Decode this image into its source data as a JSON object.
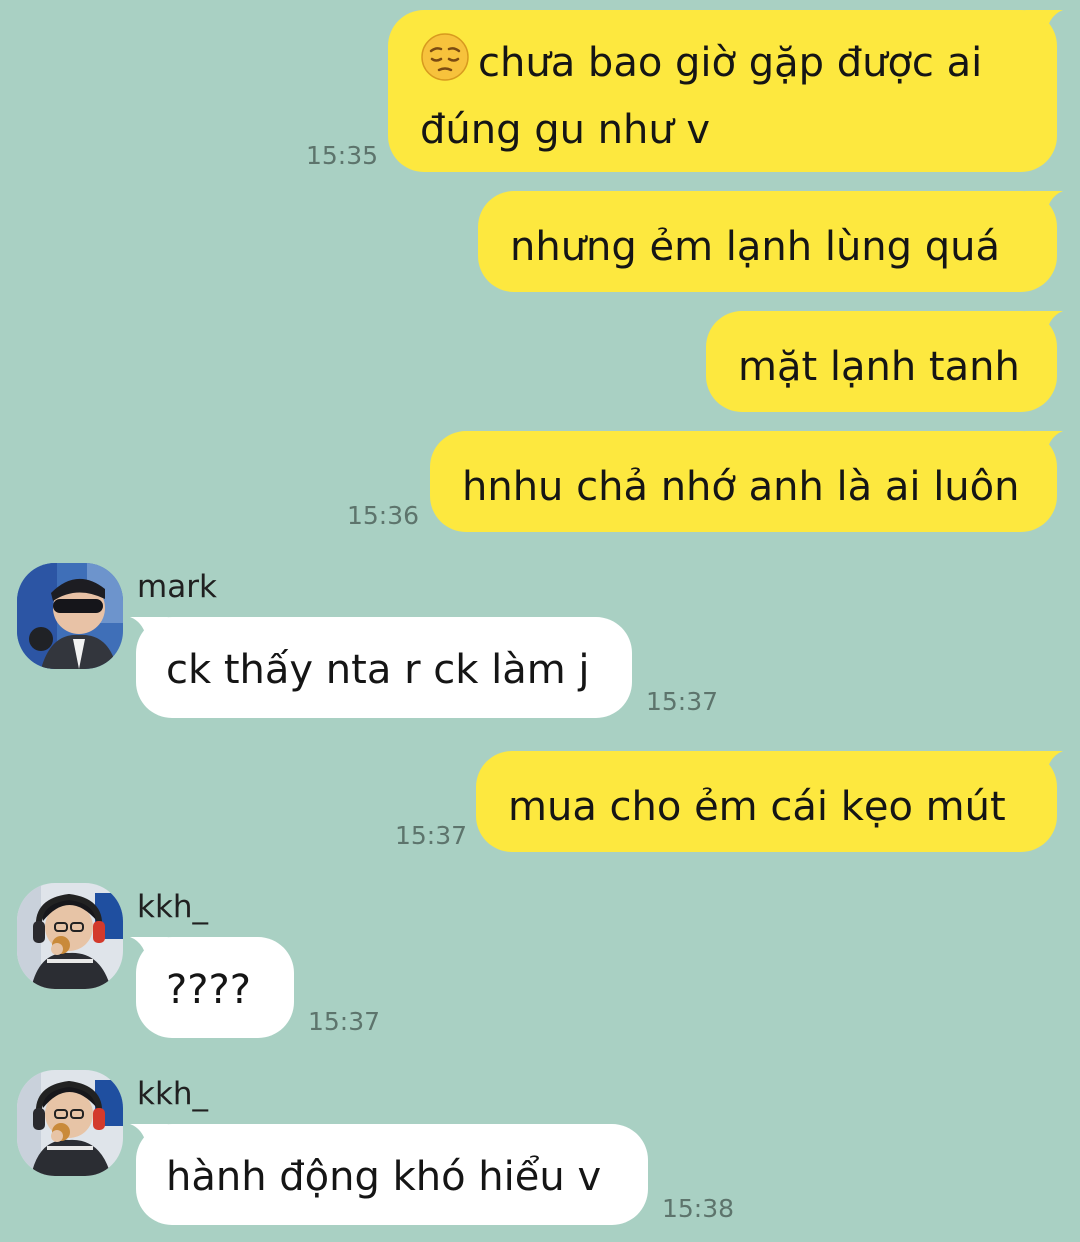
{
  "chat": {
    "messages": [
      {
        "id": "m1",
        "direction": "outgoing",
        "time": "15:35",
        "emoji": "pensive-face",
        "line1": "chưa bao giờ gặp được ai",
        "line2": "đúng gu như v"
      },
      {
        "id": "m2",
        "direction": "outgoing",
        "text": "nhưng ẻm lạnh lùng quá"
      },
      {
        "id": "m3",
        "direction": "outgoing",
        "text": "mặt lạnh tanh"
      },
      {
        "id": "m4",
        "direction": "outgoing",
        "time": "15:36",
        "text": "hnhu chả nhớ anh là ai luôn"
      },
      {
        "id": "m5",
        "direction": "incoming",
        "sender": "mark",
        "time": "15:37",
        "text": "ck thấy nta r ck làm j"
      },
      {
        "id": "m6",
        "direction": "outgoing",
        "time": "15:37",
        "text": "mua cho ẻm cái kẹo mút"
      },
      {
        "id": "m7",
        "direction": "incoming",
        "sender": "kkh_",
        "time": "15:37",
        "text": "????"
      },
      {
        "id": "m8",
        "direction": "incoming",
        "sender": "kkh_",
        "time": "15:38",
        "text": "hành động khó hiểu v"
      }
    ]
  },
  "colors": {
    "background": "#a9d0c3",
    "outgoing_bubble": "#fde83f",
    "incoming_bubble": "#ffffff",
    "timestamp": "#5d746c"
  }
}
